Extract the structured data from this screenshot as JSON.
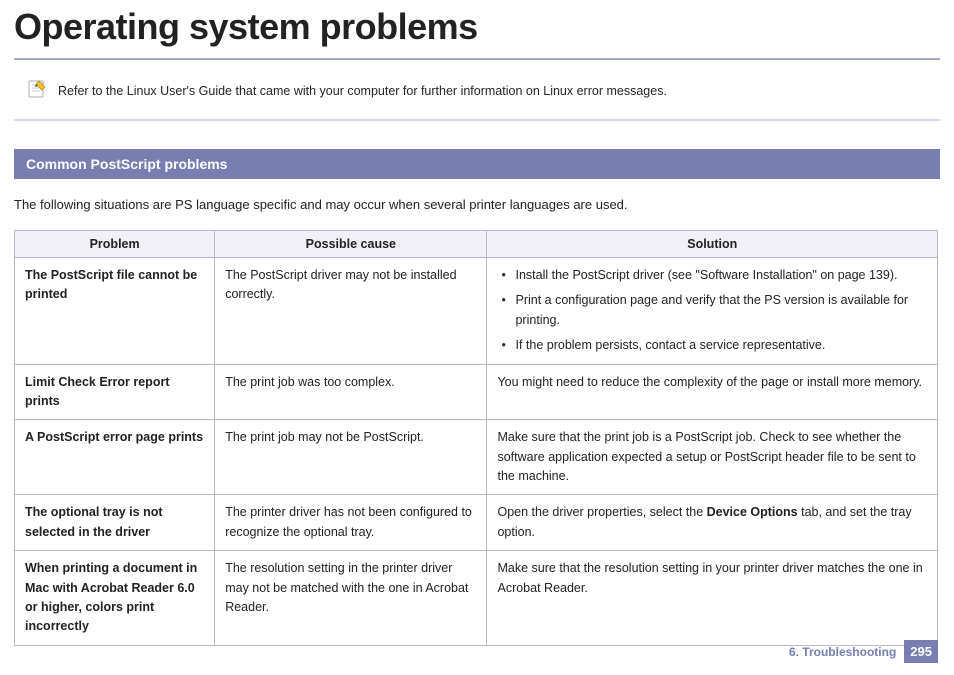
{
  "title": "Operating system problems",
  "note": {
    "text": "Refer to the Linux User's Guide that came with your computer for further information on Linux error messages."
  },
  "section": {
    "header": "Common PostScript problems",
    "intro": "The following situations are PS language specific and may occur when several printer languages are used."
  },
  "table": {
    "headers": {
      "problem": "Problem",
      "cause": "Possible cause",
      "solution": "Solution"
    },
    "rows": [
      {
        "problem": "The PostScript file cannot be printed",
        "cause": "The PostScript driver may not be installed correctly.",
        "solution_list": [
          "Install the PostScript driver (see \"Software Installation\" on page 139).",
          "Print a configuration page and verify that the PS version is available for printing.",
          "If the problem persists, contact a service representative."
        ]
      },
      {
        "problem": "Limit Check Error report prints",
        "cause": "The print job was too complex.",
        "solution": "You might need to reduce the complexity of the page or install more memory."
      },
      {
        "problem": "A PostScript error page prints",
        "cause": "The print job may not be PostScript.",
        "solution": "Make sure that the print job is a PostScript job. Check to see whether the software application expected a setup or PostScript header file to be sent to the machine."
      },
      {
        "problem": "The optional tray is not selected in the driver",
        "cause": "The printer driver has not been configured to recognize the optional tray.",
        "solution_pre": "Open the driver properties, select the ",
        "solution_bold": "Device Options",
        "solution_post": " tab, and set the tray option."
      },
      {
        "problem": "When printing a document in Mac with Acrobat Reader 6.0 or higher, colors print incorrectly",
        "cause": "The resolution setting in the printer driver may not be matched with the one in Acrobat Reader.",
        "solution": "Make sure that the resolution setting in your printer driver matches the one in Acrobat Reader."
      }
    ]
  },
  "footer": {
    "chapter": "6.  Troubleshooting",
    "page": "295"
  }
}
